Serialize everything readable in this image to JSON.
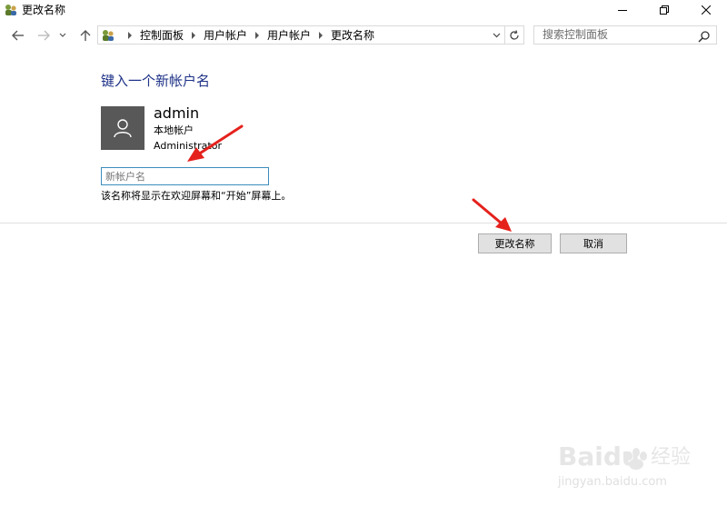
{
  "window": {
    "title": "更改名称",
    "icon": "control-panel-users-icon"
  },
  "address": {
    "breadcrumbs": [
      "控制面板",
      "用户帐户",
      "用户帐户",
      "更改名称"
    ],
    "search_placeholder": "搜索控制面板"
  },
  "content": {
    "heading": "键入一个新帐户名",
    "account": {
      "name": "admin",
      "type": "本地帐户",
      "group": "Administrator"
    },
    "new_name_placeholder": "新帐户名",
    "hint": "该名称将显示在欢迎屏幕和“开始”屏幕上。"
  },
  "buttons": {
    "change_name": "更改名称",
    "cancel": "取消"
  },
  "annotations": {
    "arrow_color": "#e5211c"
  },
  "watermark": {
    "brand": "Baidu",
    "brand_cn": "经验",
    "url": "jingyan.baidu.com"
  }
}
